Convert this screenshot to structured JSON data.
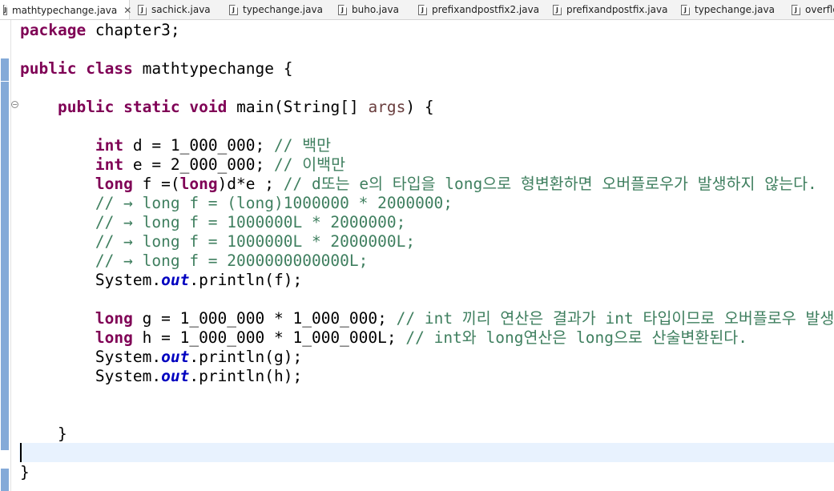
{
  "tabs": [
    {
      "label": "mathtypechange.java",
      "active": true,
      "icon": "java-file-icon"
    },
    {
      "label": "sachick.java",
      "icon": "java-file-icon"
    },
    {
      "label": "typechange.java",
      "icon": "java-file-icon"
    },
    {
      "label": "buho.java",
      "icon": "java-file-icon"
    },
    {
      "label": "prefixandpostfix2.java",
      "icon": "java-file-icon"
    },
    {
      "label": "prefixandpostfix.java",
      "icon": "java-file-icon"
    },
    {
      "label": "typechange.java",
      "icon": "java-file-icon"
    },
    {
      "label": "overflow",
      "icon": "java-file-icon"
    }
  ],
  "colors": {
    "keyword": "#7f0055",
    "comment": "#3f7f5f",
    "static_field": "#0000c0",
    "current_line": "#e8f2fe",
    "change_marker": "#6f9bd1"
  },
  "code_lines": [
    [
      {
        "t": "kw",
        "v": "package"
      },
      {
        "t": "p",
        "v": " chapter3;"
      }
    ],
    [],
    [
      {
        "t": "kw",
        "v": "public"
      },
      {
        "t": "p",
        "v": " "
      },
      {
        "t": "kw",
        "v": "class"
      },
      {
        "t": "p",
        "v": " mathtypechange {"
      }
    ],
    [],
    [
      {
        "t": "p",
        "v": "    "
      },
      {
        "t": "kw",
        "v": "public"
      },
      {
        "t": "p",
        "v": " "
      },
      {
        "t": "kw",
        "v": "static"
      },
      {
        "t": "p",
        "v": " "
      },
      {
        "t": "kw",
        "v": "void"
      },
      {
        "t": "p",
        "v": " main(String[] "
      },
      {
        "t": "var",
        "v": "args"
      },
      {
        "t": "p",
        "v": ") {"
      }
    ],
    [],
    [
      {
        "t": "p",
        "v": "        "
      },
      {
        "t": "kw",
        "v": "int"
      },
      {
        "t": "p",
        "v": " d = 1_000_000; "
      },
      {
        "t": "cm",
        "v": "// 백만"
      }
    ],
    [
      {
        "t": "p",
        "v": "        "
      },
      {
        "t": "kw",
        "v": "int"
      },
      {
        "t": "p",
        "v": " e = 2_000_000; "
      },
      {
        "t": "cm",
        "v": "// 이백만"
      }
    ],
    [
      {
        "t": "p",
        "v": "        "
      },
      {
        "t": "kw",
        "v": "long"
      },
      {
        "t": "p",
        "v": " f =("
      },
      {
        "t": "kw",
        "v": "long"
      },
      {
        "t": "p",
        "v": ")d*e ; "
      },
      {
        "t": "cm",
        "v": "// d또는 e의 타입을 long으로 형변환하면 오버플로우가 발생하지 않는다."
      }
    ],
    [
      {
        "t": "p",
        "v": "        "
      },
      {
        "t": "cm",
        "v": "// → long f = (long)1000000 * 2000000;"
      }
    ],
    [
      {
        "t": "p",
        "v": "        "
      },
      {
        "t": "cm",
        "v": "// → long f = 1000000L * 2000000;"
      }
    ],
    [
      {
        "t": "p",
        "v": "        "
      },
      {
        "t": "cm",
        "v": "// → long f = 1000000L * 2000000L;"
      }
    ],
    [
      {
        "t": "p",
        "v": "        "
      },
      {
        "t": "cm",
        "v": "// → long f = 2000000000000L;"
      }
    ],
    [
      {
        "t": "p",
        "v": "        System."
      },
      {
        "t": "fld",
        "v": "out"
      },
      {
        "t": "p",
        "v": ".println(f);"
      }
    ],
    [],
    [
      {
        "t": "p",
        "v": "        "
      },
      {
        "t": "kw",
        "v": "long"
      },
      {
        "t": "p",
        "v": " g = 1_000_000 * 1_000_000; "
      },
      {
        "t": "cm",
        "v": "// int 끼리 연산은 결과가 int 타입이므로 오버플로우 발생!"
      }
    ],
    [
      {
        "t": "p",
        "v": "        "
      },
      {
        "t": "kw",
        "v": "long"
      },
      {
        "t": "p",
        "v": " h = 1_000_000 * 1_000_000L; "
      },
      {
        "t": "cm",
        "v": "// int와 long연산은 long으로 산술변환된다."
      }
    ],
    [
      {
        "t": "p",
        "v": "        System."
      },
      {
        "t": "fld",
        "v": "out"
      },
      {
        "t": "p",
        "v": ".println(g);"
      }
    ],
    [
      {
        "t": "p",
        "v": "        System."
      },
      {
        "t": "fld",
        "v": "out"
      },
      {
        "t": "p",
        "v": ".println(h);"
      }
    ],
    [],
    [],
    [
      {
        "t": "p",
        "v": "    }"
      }
    ],
    [],
    [
      {
        "t": "p",
        "v": "}"
      }
    ]
  ]
}
